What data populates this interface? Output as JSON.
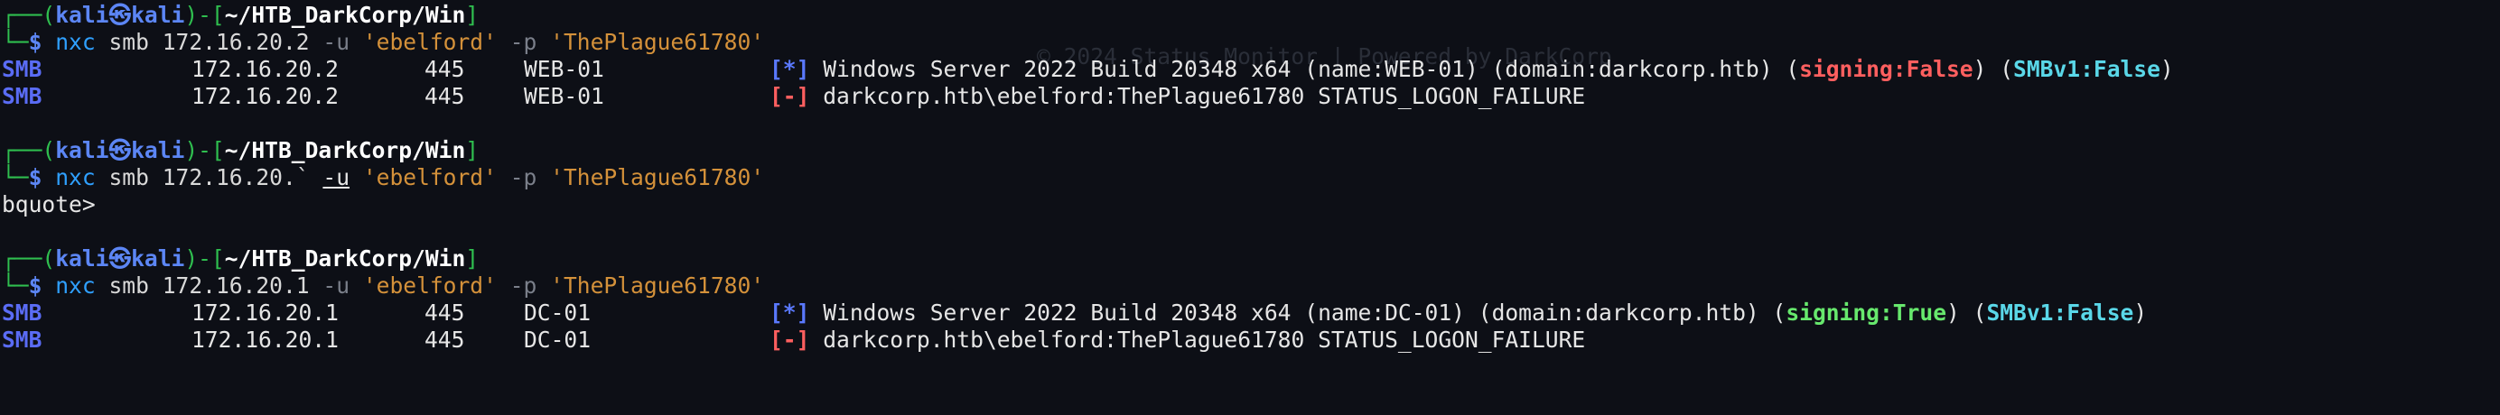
{
  "watermark": "© 2024 Status Monitor | Powered by DarkCorp",
  "prompt": {
    "top_left": "┌──(",
    "user": "kali",
    "at": "㉿",
    "host": "kali",
    "mid": ")-[",
    "path": "~/HTB_DarkCorp/Win",
    "end": "]",
    "bottom_left": "└─",
    "dollar": "$"
  },
  "blocks": [
    {
      "command": {
        "bin": "nxc",
        "proto": "smb",
        "target": "172.16.20.2",
        "user_flag": "-u",
        "user": "'ebelford'",
        "pass_flag": "-p",
        "pass": "'ThePlague61780'"
      },
      "rows": [
        {
          "proto": "SMB",
          "ip": "172.16.20.2",
          "port": "445",
          "host": "WEB-01",
          "tag": "[*]",
          "msg": "Windows Server 2022 Build 20348 x64 (name:WEB-01) (domain:darkcorp.htb) (",
          "signing": "signing:False",
          "mid": ") (",
          "smbv1": "SMBv1:False",
          "close": ")"
        },
        {
          "proto": "SMB",
          "ip": "172.16.20.2",
          "port": "445",
          "host": "WEB-01",
          "tag": "[-]",
          "msg": "darkcorp.htb\\ebelford:ThePlague61780 STATUS_LOGON_FAILURE"
        }
      ]
    },
    {
      "command": {
        "bin": "nxc",
        "proto": "smb",
        "target": "172.16.20.`",
        "user_flag": "-u",
        "user": "'ebelford'",
        "pass_flag": "-p",
        "pass": "'ThePlague61780'"
      },
      "continuation": "bquote>"
    },
    {
      "command": {
        "bin": "nxc",
        "proto": "smb",
        "target": "172.16.20.1",
        "user_flag": "-u",
        "user": "'ebelford'",
        "pass_flag": "-p",
        "pass": "'ThePlague61780'"
      },
      "rows": [
        {
          "proto": "SMB",
          "ip": "172.16.20.1",
          "port": "445",
          "host": "DC-01",
          "tag": "[*]",
          "msg": "Windows Server 2022 Build 20348 x64 (name:DC-01) (domain:darkcorp.htb) (",
          "signing": "signing:True",
          "mid": ") (",
          "smbv1": "SMBv1:False",
          "close": ")"
        },
        {
          "proto": "SMB",
          "ip": "172.16.20.1",
          "port": "445",
          "host": "DC-01",
          "tag": "[-]",
          "msg": "darkcorp.htb\\ebelford:ThePlague61780 STATUS_LOGON_FAILURE"
        }
      ]
    }
  ],
  "colors": {
    "background": "#0d0f16",
    "prompt_green": "#2fbf4f",
    "user_blue": "#5c86f5",
    "string_orange": "#d4913a",
    "fail_red": "#ff5f5f",
    "ok_green": "#67e86d",
    "smbv1_cyan": "#5ad7e8"
  }
}
